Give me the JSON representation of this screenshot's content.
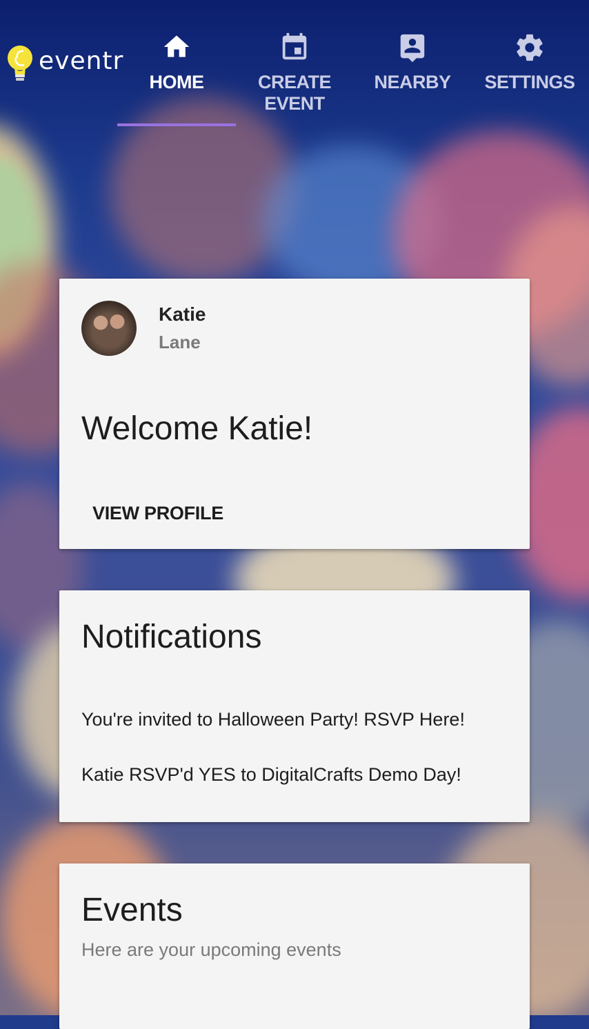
{
  "app": {
    "logo_text": "eventr"
  },
  "nav": {
    "tabs": [
      {
        "label": "HOME",
        "icon": "home-icon",
        "active": true
      },
      {
        "label": "CREATE EVENT",
        "icon": "calendar-icon",
        "active": false
      },
      {
        "label": "NEARBY",
        "icon": "contact-pin-icon",
        "active": false
      },
      {
        "label": "SETTINGS",
        "icon": "gear-icon",
        "active": false
      }
    ]
  },
  "profile_card": {
    "first_name": "Katie",
    "last_name": "Lane",
    "welcome": "Welcome Katie!",
    "view_profile_label": "VIEW PROFILE"
  },
  "notifications_card": {
    "title": "Notifications",
    "items": [
      "You're invited to Halloween Party! RSVP Here!",
      "Katie RSVP'd YES to DigitalCrafts Demo Day!"
    ]
  },
  "events_card": {
    "title": "Events",
    "subtitle": "Here are your upcoming events"
  },
  "colors": {
    "accent_indicator": "#9a72e0",
    "card_background": "#f4f4f4",
    "bulb": "#f5e33b"
  }
}
